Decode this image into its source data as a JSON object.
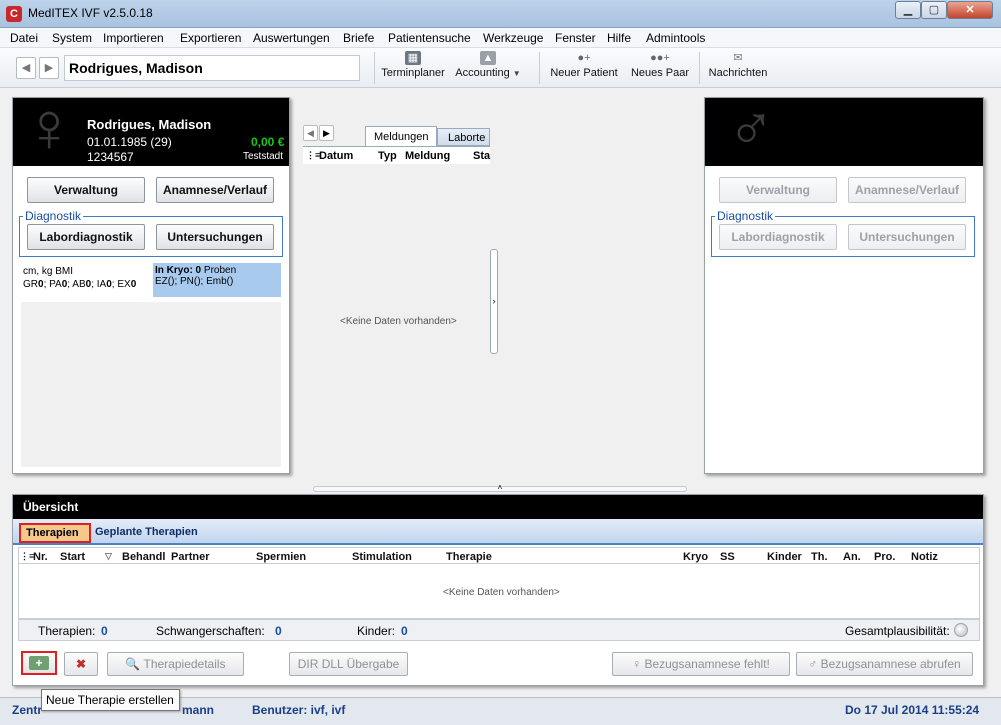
{
  "window": {
    "title": "MedITEX IVF v2.5.0.18",
    "min_label": "▁",
    "max_label": "▢",
    "close_label": "✕"
  },
  "menu": [
    "Datei",
    "System",
    "Importieren",
    "Exportieren",
    "Auswertungen",
    "Briefe",
    "Patientensuche",
    "Werkzeuge",
    "Fenster",
    "Hilfe",
    "Admintools"
  ],
  "toolbar": {
    "patient_name": "Rodrigues, Madison",
    "buttons": [
      {
        "label": "Terminplaner",
        "icon": "calendar-icon"
      },
      {
        "label": "Accounting",
        "icon": "accounting-icon"
      },
      {
        "label": "Neuer Patient",
        "icon": "new-patient-icon"
      },
      {
        "label": "Neues Paar",
        "icon": "new-couple-icon"
      },
      {
        "label": "Nachrichten",
        "icon": "mail-icon"
      }
    ]
  },
  "female_panel": {
    "name": "Rodrigues, Madison",
    "dob_age": "01.01.1985  (29)",
    "id": "1234567",
    "balance": "0,00 €",
    "city": "Teststadt",
    "balance_color": "#14c814",
    "btn_verwaltung": "Verwaltung",
    "btn_anamnese": "Anamnese/Verlauf",
    "diag_label": "Diagnostik",
    "btn_labor": "Labordiagnostik",
    "btn_untersuchungen": "Untersuchungen",
    "info_line1": "cm, kg BMI",
    "info_line2_prefix": "GR",
    "info_gr": "0",
    "info_pa_prefix": "; PA",
    "info_pa": "0",
    "info_ab_prefix": "; AB",
    "info_ab": "0",
    "info_ia_prefix": "; IA",
    "info_ia": "0",
    "info_ex_prefix": "; EX",
    "info_ex": "0",
    "kryo_label": "In Kryo: 0",
    "kryo_suffix": " Proben",
    "kryo_line2": "EZ(); PN(); Emb()"
  },
  "center_panel": {
    "tabs": [
      "Meldungen",
      "Laborte"
    ],
    "columns": [
      "Datum",
      "Typ",
      "Meldung",
      "Sta"
    ],
    "empty_text": "<Keine Daten vorhanden>"
  },
  "male_panel": {
    "btn_verwaltung": "Verwaltung",
    "btn_anamnese": "Anamnese/Verlauf",
    "diag_label": "Diagnostik",
    "btn_labor": "Labordiagnostik",
    "btn_untersuchungen": "Untersuchungen"
  },
  "overview": {
    "title": "Übersicht",
    "tabs": [
      "Therapien",
      "Geplante Therapien"
    ],
    "columns": [
      "Nr.",
      "Start",
      "Behandl",
      "Partner",
      "Spermien",
      "Stimulation",
      "Therapie",
      "Kryo",
      "SS",
      "Kinder",
      "Th.",
      "An.",
      "Pro.",
      "Notiz"
    ],
    "empty_text": "<Keine Daten vorhanden>",
    "summary": {
      "therapien_label": "Therapien:",
      "therapien_value": "0",
      "schwanger_label": "Schwangerschaften:",
      "schwanger_value": "0",
      "kinder_label": "Kinder:",
      "kinder_value": "0",
      "plausi_label": "Gesamtplausibilität:"
    },
    "buttons": {
      "details": "Therapiedetails",
      "dir_dll": "DIR DLL Übergabe",
      "bezug_fehlt": "Bezugsanamnese fehlt!",
      "bezug_abrufen": "Bezugsanamnese abrufen"
    },
    "tooltip": "Neue Therapie erstellen"
  },
  "status": {
    "left_text": "Zentr",
    "mid_fragment": "mann",
    "user": "Benutzer: ivf, ivf",
    "datetime": "Do 17 Jul 2014 11:55:24"
  },
  "colors": {
    "accent_blue": "#1a4ea0",
    "highlight_red": "#e02020",
    "kryo_bg": "#a9caef"
  }
}
